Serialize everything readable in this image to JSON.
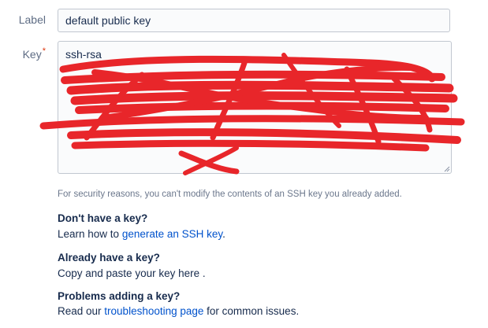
{
  "form": {
    "label_field": {
      "label": "Label",
      "value": "default public key"
    },
    "key_field": {
      "label": "Key",
      "required_marker": "*",
      "value_visible": "ssh-rsa"
    },
    "help_text": "For security reasons, you can't modify the contents of an SSH key you already added."
  },
  "sections": [
    {
      "title": "Don't have a key?",
      "prefix": "Learn how to ",
      "link": "generate an SSH key",
      "suffix": "."
    },
    {
      "title": "Already have a key?",
      "text": "Copy and paste your key here ."
    },
    {
      "title": "Problems adding a key?",
      "prefix": "Read our ",
      "link": "troubleshooting page",
      "suffix": " for common issues."
    }
  ],
  "colors": {
    "redaction": "#e8262a",
    "link": "#0052cc",
    "text": "#172b4d",
    "muted": "#6b778c"
  }
}
